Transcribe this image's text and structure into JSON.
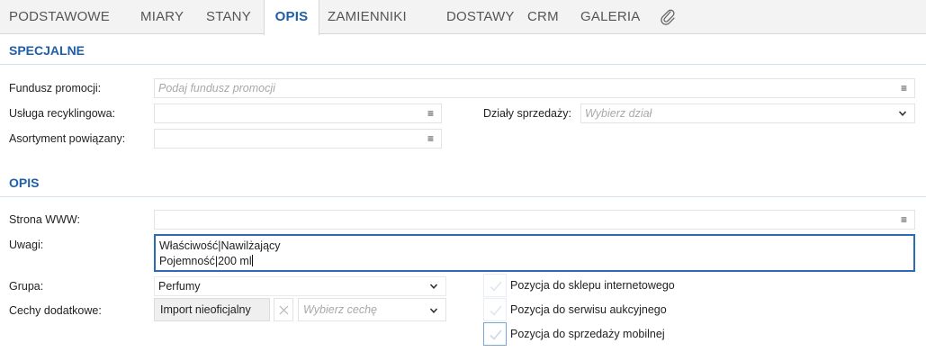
{
  "tabs": [
    {
      "label": "PODSTAWOWE"
    },
    {
      "label": "MIARY"
    },
    {
      "label": "STANY"
    },
    {
      "label": "OPIS"
    },
    {
      "label": "ZAMIENNIKI"
    },
    {
      "label": "DOSTAWY"
    },
    {
      "label": "CRM"
    },
    {
      "label": "GALERIA"
    }
  ],
  "active_tab": "OPIS",
  "specjalne": {
    "title": "SPECJALNE",
    "fundusz_label": "Fundusz promocji:",
    "fundusz_placeholder": "Podaj fundusz promocji",
    "recykling_label": "Usługa recyklingowa:",
    "dzialy_label": "Działy sprzedaży:",
    "dzialy_placeholder": "Wybierz dział",
    "asortyment_label": "Asortyment powiązany:"
  },
  "opis": {
    "title": "OPIS",
    "www_label": "Strona WWW:",
    "uwagi_label": "Uwagi:",
    "uwagi_line1": "Właściwość|Nawilżający",
    "uwagi_line2": "Pojemność|200 ml",
    "grupa_label": "Grupa:",
    "grupa_value": "Perfumy",
    "cechy_label": "Cechy dodatkowe:",
    "cechy_chip": "Import nieoficjalny",
    "cechy_placeholder": "Wybierz cechę",
    "chk_sklep": "Pozycja do sklepu internetowego",
    "chk_aukcje": "Pozycja do serwisu aukcyjnego",
    "chk_mobilna": "Pozycja do sprzedaży mobilnej"
  },
  "colors": {
    "accent": "#1f5fa8",
    "focus_border": "#2b6cb0",
    "tabbar_bg": "#f3f3f3"
  },
  "icons": {
    "attachment": "paperclip-icon",
    "menu": "hamburger-icon",
    "dropdown": "chevron-down-icon",
    "check": "checkmark-icon",
    "remove": "close-icon"
  }
}
